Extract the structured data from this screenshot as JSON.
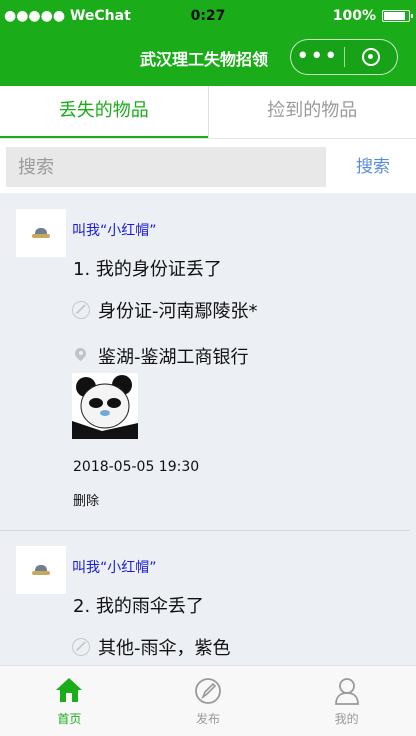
{
  "status": {
    "carrier": "●●●●● WeChat",
    "time": "0:27",
    "battery": "100%"
  },
  "nav": {
    "title": "武汉理工失物招领",
    "more": "•••"
  },
  "tabs": [
    {
      "label": "丢失的物品",
      "active": true
    },
    {
      "label": "捡到的物品",
      "active": false
    }
  ],
  "search": {
    "placeholder": "搜索",
    "button": "搜索"
  },
  "posts": [
    {
      "nickname": "叫我“小红帽”",
      "title": "1. 我的身份证丢了",
      "category": "身份证-河南鄢陵张*",
      "location": "鉴湖-鉴湖工商银行",
      "time": "2018-05-05 19:30",
      "action": "删除"
    },
    {
      "nickname": "叫我“小红帽”",
      "title": "2. 我的雨伞丢了",
      "category": "其他-雨伞，紫色"
    }
  ],
  "tabbar": [
    {
      "label": "首页",
      "icon": "home-icon",
      "active": true
    },
    {
      "label": "发布",
      "icon": "publish-icon",
      "active": false
    },
    {
      "label": "我的",
      "icon": "profile-icon",
      "active": false
    }
  ],
  "colors": {
    "brand": "#1aad19",
    "nickname": "#1b1bd6",
    "search_button": "#5b8bd6",
    "list_bg": "#eceff3"
  }
}
